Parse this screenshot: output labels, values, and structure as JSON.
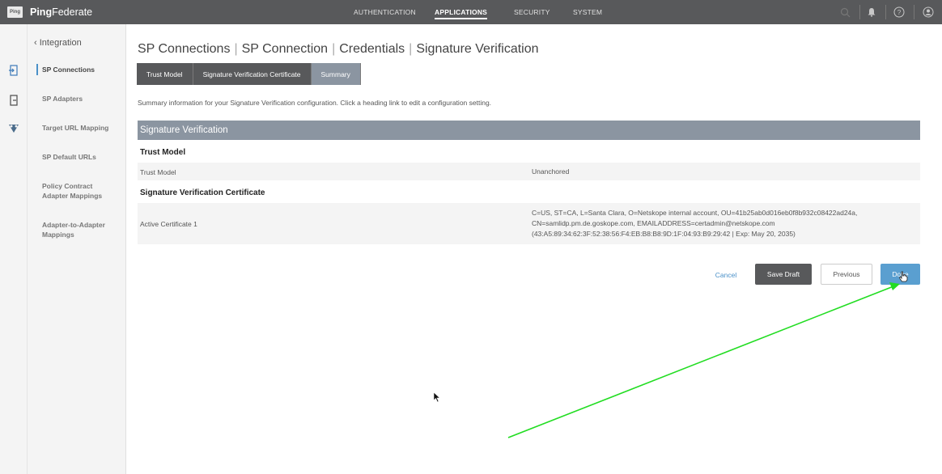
{
  "app": {
    "logo_text": "Ping",
    "title_bold": "Ping",
    "title_rest": "Federate"
  },
  "topnav": {
    "items": [
      "AUTHENTICATION",
      "APPLICATIONS",
      "SECURITY",
      "SYSTEM"
    ],
    "active": "APPLICATIONS"
  },
  "sidebar": {
    "back_label": "Integration",
    "items": [
      "SP Connections",
      "SP Adapters",
      "Target URL Mapping",
      "SP Default URLs",
      "Policy Contract Adapter Mappings",
      "Adapter-to-Adapter Mappings"
    ]
  },
  "breadcrumb": [
    "SP Connections",
    "SP Connection",
    "Credentials",
    "Signature Verification"
  ],
  "tabs": [
    "Trust Model",
    "Signature Verification Certificate",
    "Summary"
  ],
  "summary_text": "Summary information for your Signature Verification configuration. Click a heading link to edit a configuration setting.",
  "section": {
    "title": "Signature Verification",
    "trust_model_heading": "Trust Model",
    "trust_model_label": "Trust Model",
    "trust_model_value": "Unanchored",
    "cert_heading": "Signature Verification Certificate",
    "cert_label": "Active Certificate 1",
    "cert_line1": "C=US, ST=CA, L=Santa Clara, O=Netskope internal account, OU=41b25ab0d016eb0f8b932c08422ad24a,",
    "cert_line2": "CN=samlidp.pm.de.goskope.com, EMAILADDRESS=certadmin@netskope.com",
    "cert_line3": "(43:A5:89:34:62:3F:52:38:56:F4:EB:B8:B8:9D:1F:04:93:B9:29:42 | Exp: May 20, 2035)"
  },
  "buttons": {
    "cancel": "Cancel",
    "save_draft": "Save Draft",
    "previous": "Previous",
    "done": "Done"
  },
  "colors": {
    "topbar": "#58595b",
    "section_header": "#8b95a1",
    "accent": "#5a9fd0",
    "annotation_arrow": "#22dd22"
  }
}
